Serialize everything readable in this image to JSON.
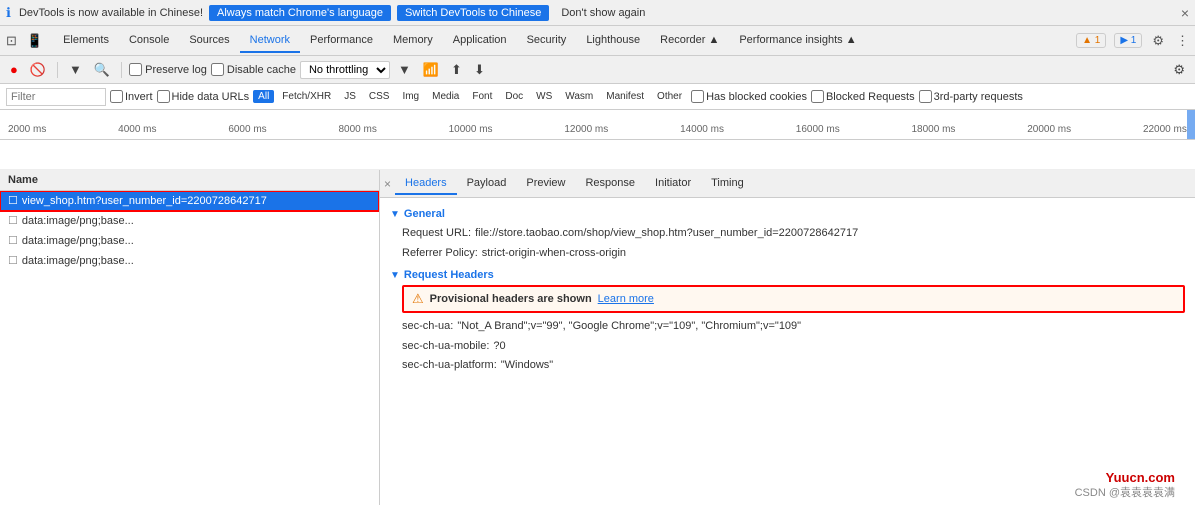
{
  "infobar": {
    "icon": "ℹ",
    "text": "DevTools is now available in Chinese!",
    "btn_match": "Always match Chrome's language",
    "btn_switch": "Switch DevTools to Chinese",
    "btn_dontshow": "Don't show again",
    "close": "×"
  },
  "tabs": {
    "items": [
      {
        "label": "Elements",
        "active": false
      },
      {
        "label": "Console",
        "active": false
      },
      {
        "label": "Sources",
        "active": false
      },
      {
        "label": "Network",
        "active": true
      },
      {
        "label": "Performance",
        "active": false
      },
      {
        "label": "Memory",
        "active": false
      },
      {
        "label": "Application",
        "active": false
      },
      {
        "label": "Security",
        "active": false
      },
      {
        "label": "Lighthouse",
        "active": false
      },
      {
        "label": "Recorder ▲",
        "active": false
      },
      {
        "label": "Performance insights ▲",
        "active": false
      }
    ],
    "badge_warn": "▲ 1",
    "badge_info": "▶ 1"
  },
  "toolbar": {
    "preserve_log": "Preserve log",
    "disable_cache": "Disable cache",
    "throttle": "No throttling"
  },
  "filter": {
    "placeholder": "Filter",
    "invert": "Invert",
    "hide_data_urls": "Hide data URLs",
    "tags": [
      "All",
      "Fetch/XHR",
      "JS",
      "CSS",
      "Img",
      "Media",
      "Font",
      "Doc",
      "WS",
      "Wasm",
      "Manifest",
      "Other"
    ],
    "has_blocked": "Has blocked cookies",
    "blocked_requests": "Blocked Requests",
    "third_party": "3rd-party requests"
  },
  "timeline": {
    "labels": [
      "2000 ms",
      "4000 ms",
      "6000 ms",
      "8000 ms",
      "10000 ms",
      "12000 ms",
      "14000 ms",
      "16000 ms",
      "18000 ms",
      "20000 ms",
      "22000 ms"
    ]
  },
  "left_panel": {
    "header": "Name",
    "files": [
      {
        "icon": "☐",
        "name": "view_shop.htm?user_number_id=2200728642717",
        "active": true,
        "selected": true
      },
      {
        "icon": "☐",
        "name": "data:image/png;base...",
        "active": false
      },
      {
        "icon": "☐",
        "name": "data:image/png;base...",
        "active": false
      },
      {
        "icon": "☐",
        "name": "data:image/png;base...",
        "active": false
      }
    ]
  },
  "detail_tabs": {
    "items": [
      "Headers",
      "Payload",
      "Preview",
      "Response",
      "Initiator",
      "Timing"
    ],
    "active": "Headers"
  },
  "general": {
    "section": "General",
    "request_url_label": "Request URL:",
    "request_url_value": "file://store.taobao.com/shop/view_shop.htm?user_number_id=2200728642717",
    "referrer_policy_label": "Referrer Policy:",
    "referrer_policy_value": "strict-origin-when-cross-origin"
  },
  "request_headers": {
    "section": "Request Headers",
    "warning_text": "Provisional headers are shown",
    "warning_link": "Learn more",
    "rows": [
      {
        "key": "sec-ch-ua:",
        "val": "\"Not_A Brand\";v=\"99\", \"Google Chrome\";v=\"109\", \"Chromium\";v=\"109\""
      },
      {
        "key": "sec-ch-ua-mobile:",
        "val": "?0"
      },
      {
        "key": "sec-ch-ua-platform:",
        "val": "\"Windows\""
      }
    ]
  },
  "watermark": "Yuucn.com",
  "watermark2": "CSDN @袁袁袁袁满"
}
